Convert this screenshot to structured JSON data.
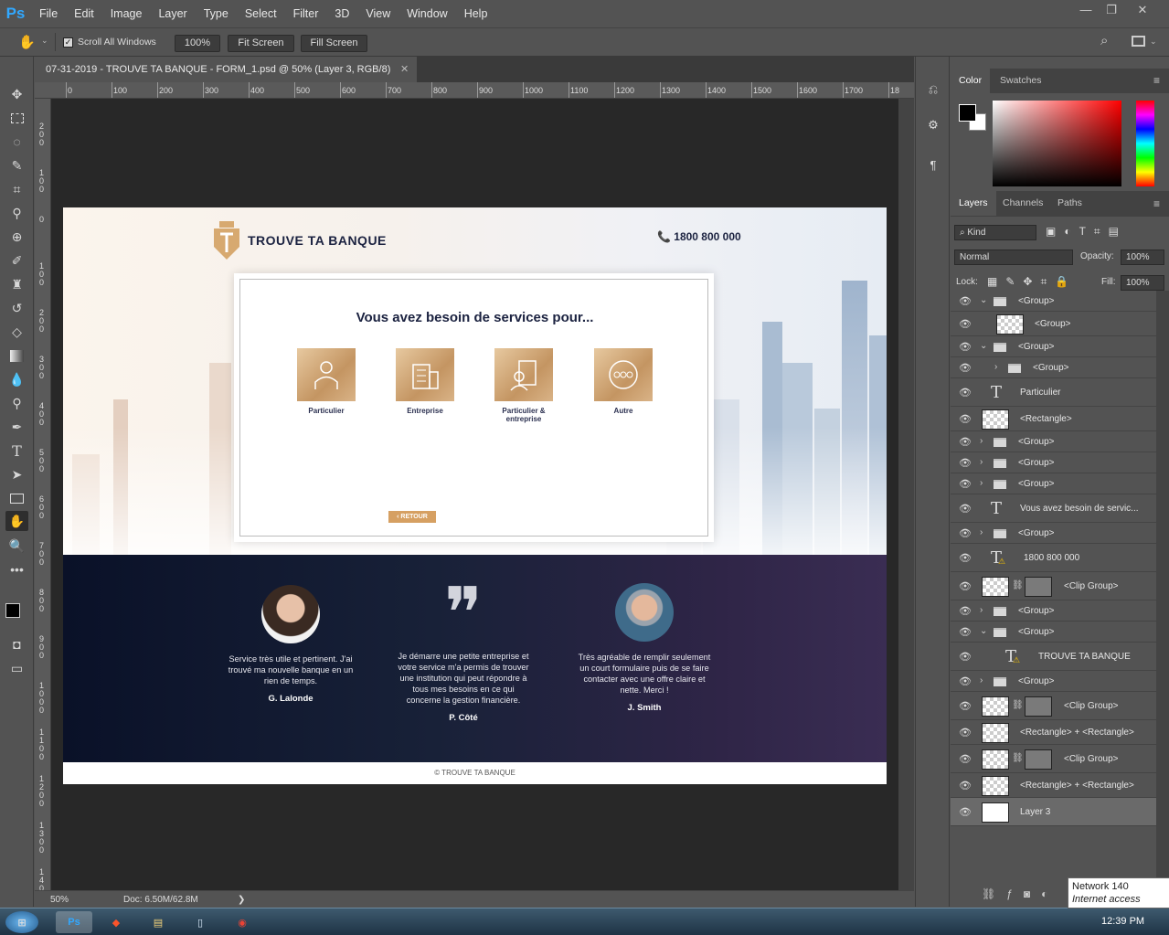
{
  "app": {
    "logo": "Ps",
    "menus": [
      "File",
      "Edit",
      "Image",
      "Layer",
      "Type",
      "Select",
      "Filter",
      "3D",
      "View",
      "Window",
      "Help"
    ],
    "window_buttons": [
      "—",
      "❐",
      "✕"
    ]
  },
  "options": {
    "scroll_all_windows": "Scroll All Windows",
    "zoom_100": "100%",
    "fit_screen": "Fit Screen",
    "fill_screen": "Fill Screen"
  },
  "document": {
    "tab_title": "07-31-2019 - TROUVE TA BANQUE  - FORM_1.psd @ 50% (Layer 3, RGB/8)",
    "close": "✕"
  },
  "ruler": {
    "h_ticks": [
      "0",
      "100",
      "200",
      "300",
      "400",
      "500",
      "600",
      "700",
      "800",
      "900",
      "1000",
      "1100",
      "1200",
      "1300",
      "1400",
      "1500",
      "1600",
      "1700",
      "18"
    ],
    "v_ticks": [
      "200",
      "100",
      "0",
      "100",
      "200",
      "300",
      "400",
      "500",
      "600",
      "700",
      "800",
      "900",
      "1000",
      "1100",
      "1200",
      "1300",
      "1400"
    ]
  },
  "status": {
    "zoom": "50%",
    "doc": "Doc: 6.50M/62.8M",
    "arrow": "❯"
  },
  "website": {
    "brand": "TROUVE TA BANQUE",
    "phone": "📞 1800 800 000",
    "card_title": "Vous avez besoin de services pour...",
    "services": [
      {
        "label": "Particulier"
      },
      {
        "label": "Entreprise"
      },
      {
        "label": "Particulier & entreprise"
      },
      {
        "label": "Autre"
      }
    ],
    "retour": "‹ RETOUR",
    "testimonials": [
      {
        "text": "Service très utile et pertinent. J'ai trouvé ma nouvelle banque en un rien de temps.",
        "name": "G. Lalonde"
      },
      {
        "text": "Je démarre une petite entreprise et votre service m'a permis de trouver une institution qui peut répondre à tous mes besoins en ce qui concerne la gestion financière.",
        "name": "P. Côté",
        "quote": "❞"
      },
      {
        "text": "Très agréable de remplir seulement un court formulaire puis de se faire contacter avec une offre claire et nette. Merci !",
        "name": "J. Smith"
      }
    ],
    "footer": "© TROUVE TA BANQUE",
    "colors": {
      "navy": "#1b2240",
      "gold": "#c49562"
    }
  },
  "color_panel": {
    "tabs": [
      "Color",
      "Swatches"
    ]
  },
  "layers_panel": {
    "tabs": [
      "Layers",
      "Channels",
      "Paths"
    ],
    "filter_kind": "Kind",
    "blend_mode": "Normal",
    "opacity_label": "Opacity:",
    "opacity": "100%",
    "lock_label": "Lock:",
    "fill_label": "Fill:",
    "fill": "100%",
    "layers": [
      {
        "name": "<Group>",
        "kind": "group-open",
        "indent": 0
      },
      {
        "name": "<Group>",
        "kind": "thumb",
        "indent": 1
      },
      {
        "name": "<Group>",
        "kind": "group-open",
        "indent": 0
      },
      {
        "name": "<Group>",
        "kind": "group",
        "indent": 1
      },
      {
        "name": "Particulier",
        "kind": "text",
        "indent": 0
      },
      {
        "name": "<Rectangle>",
        "kind": "thumb",
        "indent": 0
      },
      {
        "name": "<Group>",
        "kind": "group",
        "indent": 0
      },
      {
        "name": "<Group>",
        "kind": "group",
        "indent": 0
      },
      {
        "name": "<Group>",
        "kind": "group",
        "indent": 0
      },
      {
        "name": "Vous avez besoin de servic...",
        "kind": "text",
        "indent": 0
      },
      {
        "name": "<Group>",
        "kind": "group",
        "indent": 0
      },
      {
        "name": "1800 800 000",
        "kind": "text-warn",
        "indent": 0
      },
      {
        "name": "<Clip Group>",
        "kind": "clip",
        "indent": 0
      },
      {
        "name": "<Group>",
        "kind": "group",
        "indent": 0
      },
      {
        "name": "<Group>",
        "kind": "group-open",
        "indent": 0
      },
      {
        "name": "TROUVE TA BANQUE",
        "kind": "text-warn",
        "indent": 1
      },
      {
        "name": "<Group>",
        "kind": "group",
        "indent": 0
      },
      {
        "name": "<Clip Group>",
        "kind": "clip",
        "indent": 0
      },
      {
        "name": "<Rectangle> + <Rectangle>",
        "kind": "thumb",
        "indent": 0
      },
      {
        "name": "<Clip Group>",
        "kind": "clip",
        "indent": 0
      },
      {
        "name": "<Rectangle> + <Rectangle>",
        "kind": "thumb",
        "indent": 0
      },
      {
        "name": "Layer 3",
        "kind": "white",
        "indent": 0
      }
    ]
  },
  "tooltip": {
    "line1": "Network 140",
    "line2": "Internet access"
  },
  "taskbar": {
    "clock": "12:39 PM"
  }
}
